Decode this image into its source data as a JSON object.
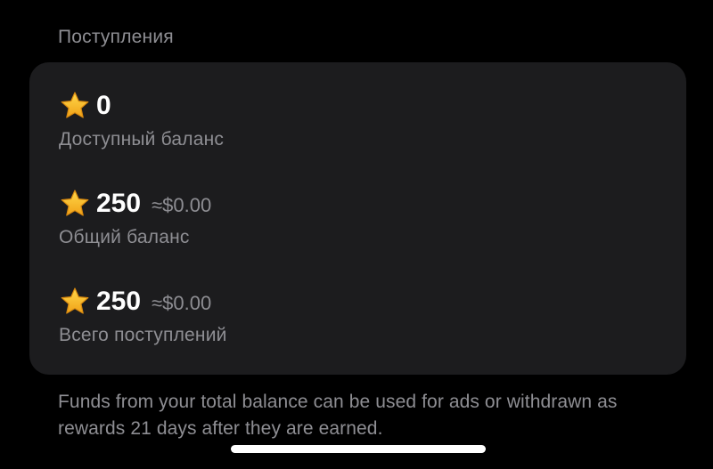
{
  "section": {
    "title": "Поступления"
  },
  "balances": [
    {
      "icon": "star-icon",
      "amount": "0",
      "usd": "",
      "label": "Доступный баланс"
    },
    {
      "icon": "star-icon",
      "amount": "250",
      "usd": "≈$0.00",
      "label": "Общий баланс"
    },
    {
      "icon": "star-icon",
      "amount": "250",
      "usd": "≈$0.00",
      "label": "Всего поступлений"
    }
  ],
  "footer": {
    "note": "Funds from your total balance can be used for ads or withdrawn as rewards 21 days after they are earned."
  },
  "colors": {
    "background": "#000000",
    "card": "#1c1c1e",
    "secondary_text": "#8e8e93",
    "star": "#f5b51f"
  }
}
